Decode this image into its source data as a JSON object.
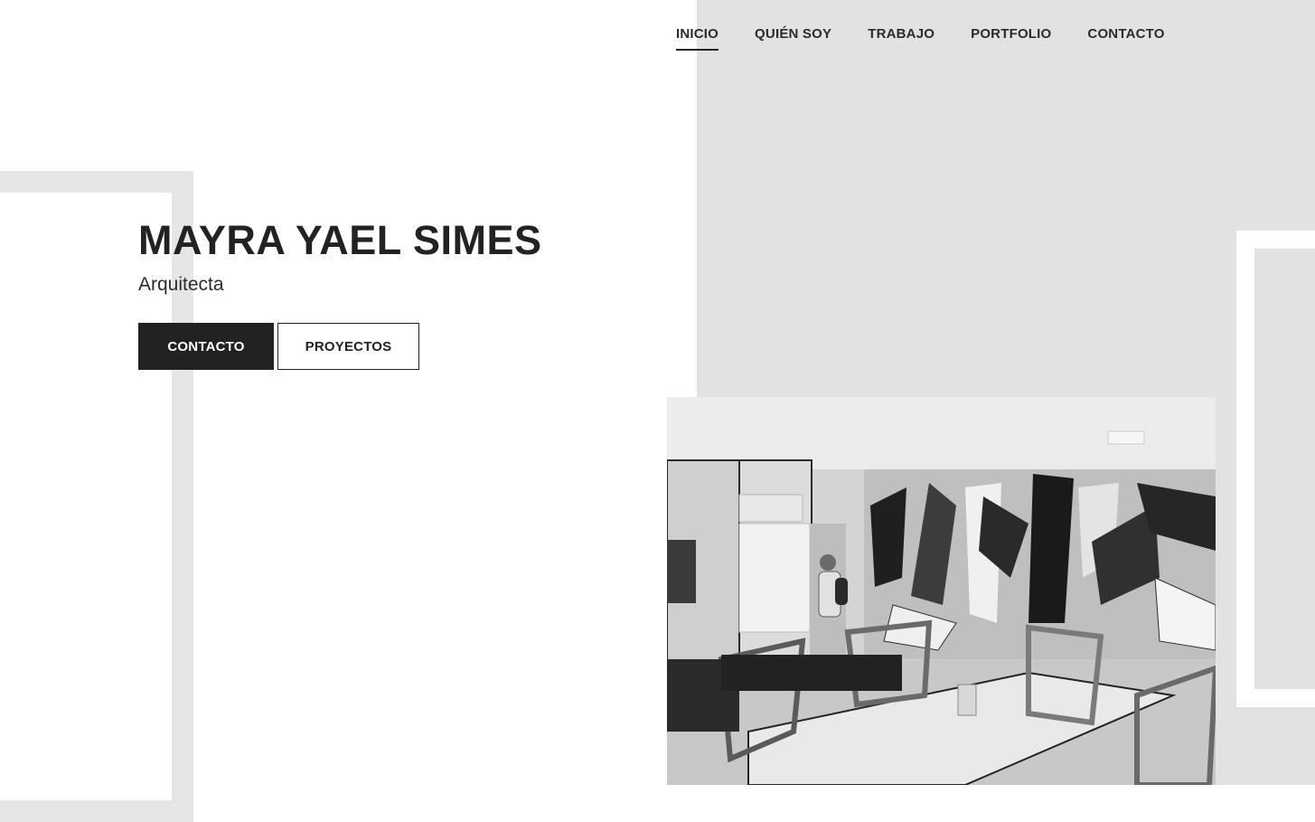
{
  "nav": {
    "items": [
      {
        "label": "INICIO",
        "active": true
      },
      {
        "label": "QUIÉN SOY",
        "active": false
      },
      {
        "label": "TRABAJO",
        "active": false
      },
      {
        "label": "PORTFOLIO",
        "active": false
      },
      {
        "label": "CONTACTO",
        "active": false
      }
    ]
  },
  "hero": {
    "title": "MAYRA YAEL SIMES",
    "subtitle": "Arquitecta",
    "primary_button": "CONTACTO",
    "secondary_button": "PROYECTOS"
  },
  "colors": {
    "text": "#222222",
    "panel": "#e2e2e2",
    "frame": "#e6e6e6",
    "button_dark": "#222222"
  }
}
